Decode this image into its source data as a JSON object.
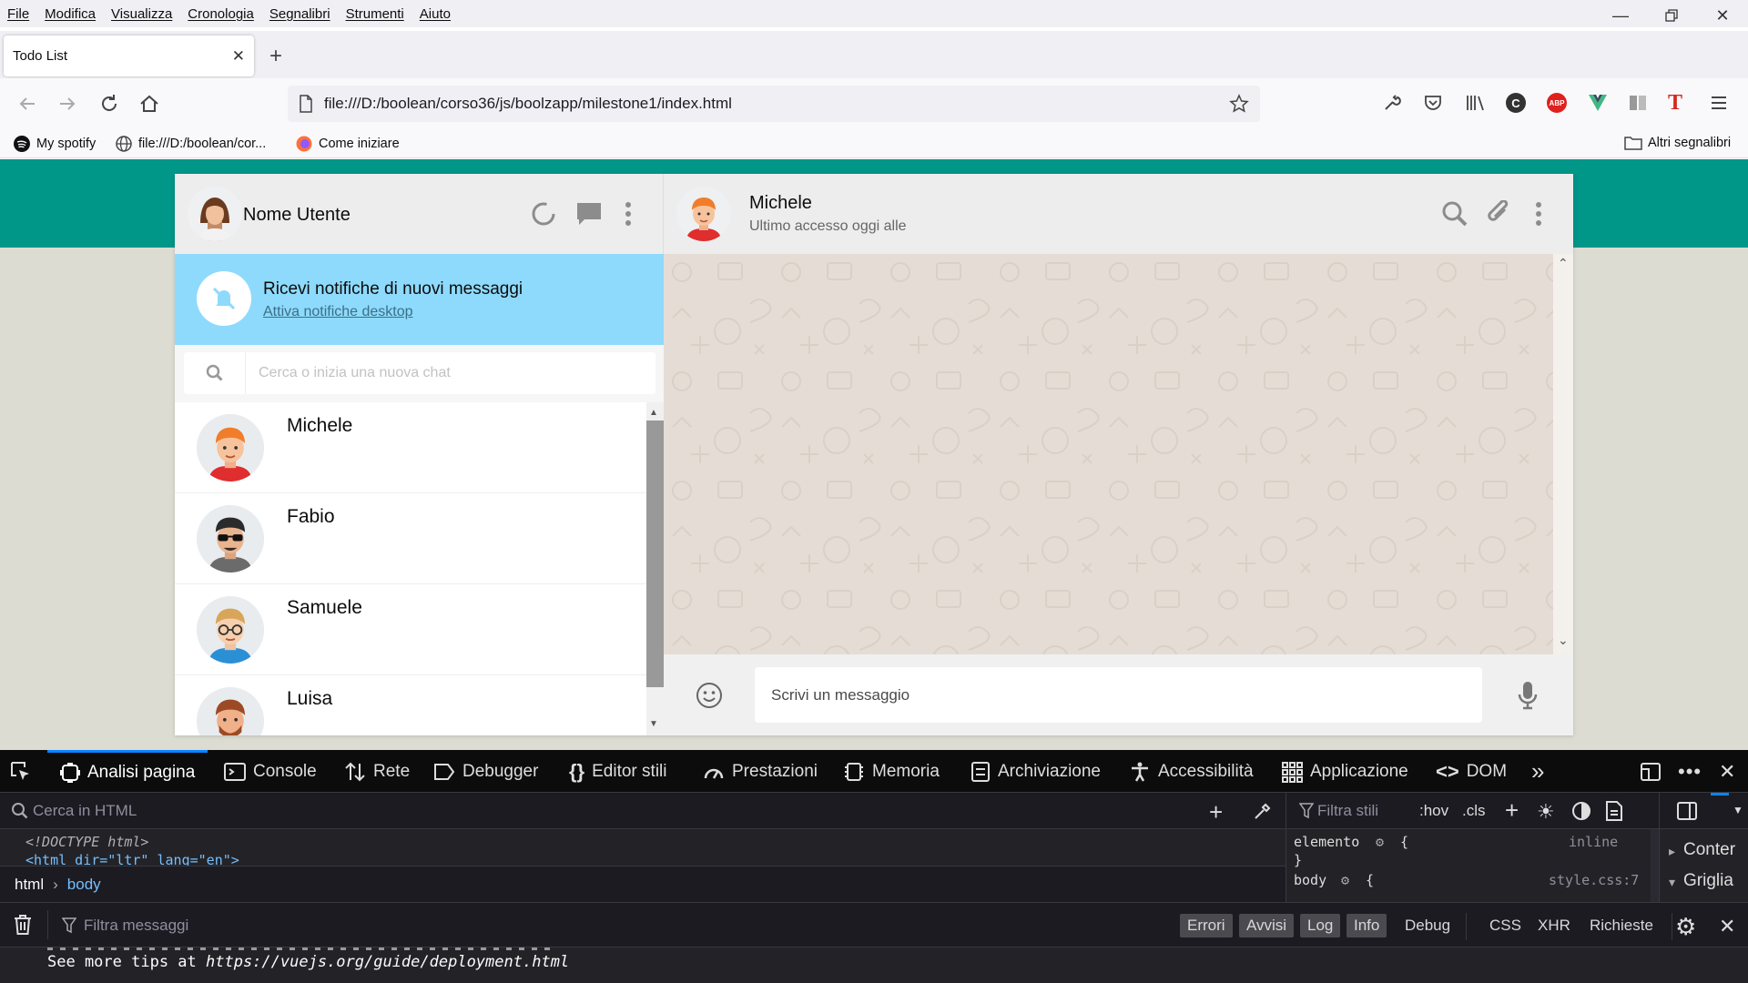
{
  "menu": [
    "File",
    "Modifica",
    "Visualizza",
    "Cronologia",
    "Segnalibri",
    "Strumenti",
    "Aiuto"
  ],
  "tab": {
    "title": "Todo List"
  },
  "url": "file:///D:/boolean/corso36/js/boolzapp/milestone1/index.html",
  "bookmarks": {
    "spotify": "My spotify",
    "file": "file:///D:/boolean/cor...",
    "start": "Come iniziare",
    "other": "Altri segnalibri"
  },
  "app": {
    "user_name": "Nome Utente",
    "notification": {
      "title": "Ricevi notifiche di nuovi messaggi",
      "link": "Attiva notifiche desktop"
    },
    "search_placeholder": "Cerca o inizia una nuova chat",
    "contacts": [
      {
        "name": "Michele"
      },
      {
        "name": "Fabio"
      },
      {
        "name": "Samuele"
      },
      {
        "name": "Luisa"
      }
    ],
    "chat": {
      "name": "Michele",
      "status": "Ultimo accesso oggi alle"
    },
    "message_placeholder": "Scrivi un messaggio"
  },
  "devtools": {
    "tabs": [
      "Analisi pagina",
      "Console",
      "Rete",
      "Debugger",
      "Editor stili",
      "Prestazioni",
      "Memoria",
      "Archiviazione",
      "Accessibilità",
      "Applicazione",
      "DOM"
    ],
    "search_html": "Cerca in HTML",
    "code_line1": "<!DOCTYPE html>",
    "code_line2": "<html dir=\"ltr\" lang=\"en\">",
    "crumb": [
      "html",
      "body"
    ],
    "filter_styles": "Filtra stili",
    "hov": ":hov",
    "cls": ".cls",
    "rule1": {
      "selector": "elemento",
      "open": "{",
      "close": "}",
      "source": "inline"
    },
    "rule2": {
      "selector": "body",
      "open": "{",
      "source": "style.css:7"
    },
    "side": [
      "Conter",
      "Griglia"
    ],
    "filter_messages": "Filtra messaggi",
    "levels": [
      "Errori",
      "Avvisi",
      "Log",
      "Info",
      "Debug"
    ],
    "types": [
      "CSS",
      "XHR",
      "Richieste"
    ],
    "output_prefix": "See more tips at ",
    "output_url": "https://vuejs.org/guide/deployment.html"
  },
  "colors": {
    "teal": "#009688",
    "notif": "#8edafc",
    "devtools_bg": "#232327",
    "active_tab": "#0a84ff"
  }
}
